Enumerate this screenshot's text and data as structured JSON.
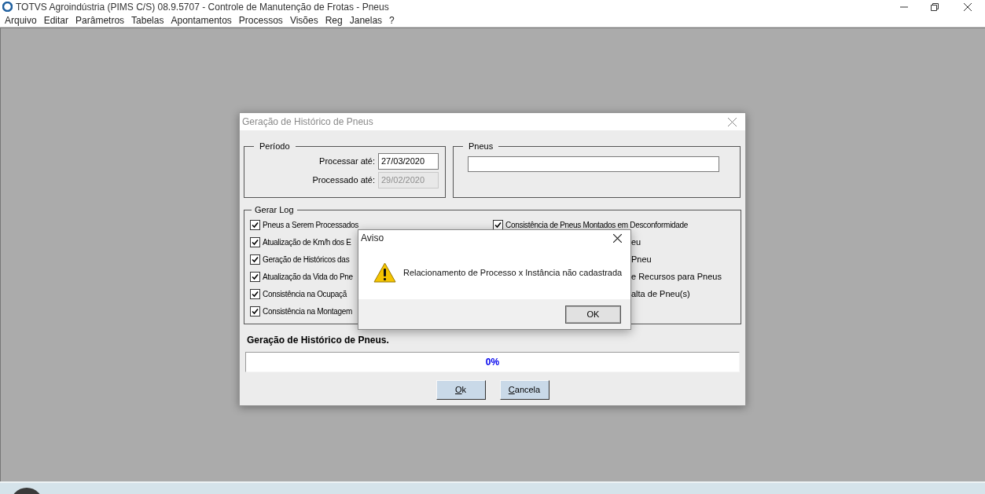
{
  "window": {
    "title": "TOTVS Agroindústria (PIMS C/S) 08.9.5707 - Controle de Manutenção de Frotas - Pneus"
  },
  "menu": [
    "Arquivo",
    "Editar",
    "Parâmetros",
    "Tabelas",
    "Apontamentos",
    "Processos",
    "Visões",
    "Reg",
    "Janelas",
    "?"
  ],
  "form_dialog": {
    "title": "Geração de Histórico de Pneus",
    "periodo": {
      "label": "Período",
      "fields": [
        {
          "label": "Processar até:",
          "value": "27/03/2020",
          "disabled": false
        },
        {
          "label": "Processado até:",
          "value": "29/02/2020",
          "disabled": true
        }
      ]
    },
    "pneus": {
      "label": "Pneus"
    },
    "gerar_log": {
      "label": "Gerar Log",
      "left": [
        {
          "kind": "checkbox",
          "label": "Pneus a Serem Processados",
          "checked": true
        },
        {
          "kind": "checkbox",
          "label": "Atualização de Km/h dos E",
          "checked": true
        },
        {
          "kind": "checkbox",
          "label": "Geração de Históricos das",
          "checked": true
        },
        {
          "kind": "checkbox",
          "label": "Atualização da Vida do Pne",
          "checked": true
        },
        {
          "kind": "checkbox",
          "label": "Consistência na Ocupaçã",
          "checked": true
        },
        {
          "kind": "checkbox",
          "label": "Consistência na Montagem",
          "checked": true
        }
      ],
      "right": [
        {
          "kind": "checkbox",
          "label": "Consistência de Pneus Montados em Desconformidade",
          "checked": true
        },
        {
          "kind": "fragment",
          "label": "eu"
        },
        {
          "kind": "fragment",
          "label": "Pneu"
        },
        {
          "kind": "fragment",
          "label": "e Recursos para Pneus"
        },
        {
          "kind": "fragment",
          "label": "alta de Pneu(s)"
        }
      ]
    },
    "status_label": "Geração de Histórico de Pneus.",
    "progress": {
      "level": 0,
      "text": "0%"
    },
    "buttons": [
      "Ok",
      "Cancela"
    ]
  },
  "alert": {
    "title": "Aviso",
    "message": "Relacionamento de Processo x Instância não cadastrada",
    "button": "OK"
  }
}
